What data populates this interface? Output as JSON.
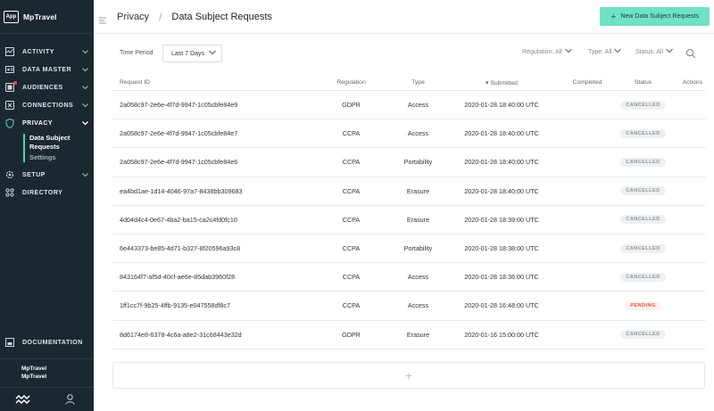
{
  "brand": {
    "logo": "App",
    "name": "MpTravel"
  },
  "nav": {
    "items": [
      {
        "label": "ACTIVITY",
        "icon": "activity-icon"
      },
      {
        "label": "DATA MASTER",
        "icon": "data-master-icon"
      },
      {
        "label": "AUDIENCES",
        "icon": "audiences-icon"
      },
      {
        "label": "CONNECTIONS",
        "icon": "connections-icon"
      },
      {
        "label": "PRIVACY",
        "icon": "shield-icon"
      },
      {
        "label": "SETUP",
        "icon": "gear-icon"
      },
      {
        "label": "DIRECTORY",
        "icon": "directory-icon"
      }
    ],
    "privacy_sub": [
      "Data Subject Requests",
      "Settings"
    ],
    "documentation": "DOCUMENTATION"
  },
  "account": {
    "line1": "MpTravel",
    "line2": "MpTravel"
  },
  "header": {
    "crumb_root": "Privacy",
    "crumb_page": "Data Subject Requests",
    "new_button": "New Data Subject Requests"
  },
  "filters": {
    "time_period_label": "Time Period",
    "time_period_value": "Last 7 Days",
    "regulation": "Regulation: All",
    "type": "Type: All",
    "status": "Status: All"
  },
  "table": {
    "headers": {
      "id": "Request ID",
      "regulation": "Regulation",
      "type": "Type",
      "submitted": "▾ Submitted",
      "completed": "Completed",
      "status": "Status",
      "actions": "Actions"
    },
    "rows": [
      {
        "id": "2a058c97-2e6e-4f7d-9947-1c05cbfe84e9",
        "regulation": "GDPR",
        "type": "Access",
        "submitted": "2020-01-28 18:40:00 UTC",
        "completed": "",
        "status": "CANCELLED"
      },
      {
        "id": "2a058c97-2e6e-4f7d-9947-1c05cbfe84e7",
        "regulation": "CCPA",
        "type": "Access",
        "submitted": "2020-01-28 18:40:00 UTC",
        "completed": "",
        "status": "CANCELLED"
      },
      {
        "id": "2a058c97-2e6e-4f7d-9947-1c05cbfe84e6",
        "regulation": "CCPA",
        "type": "Portability",
        "submitted": "2020-01-28 18:40:00 UTC",
        "completed": "",
        "status": "CANCELLED"
      },
      {
        "id": "ea4bd1ae-1d14-4046-97a7-8438bb309683",
        "regulation": "CCPA",
        "type": "Erasure",
        "submitted": "2020-01-28 18:40:00 UTC",
        "completed": "",
        "status": "CANCELLED"
      },
      {
        "id": "4d04d4c4-0e67-4ba2-ba15-ca2c4fd0fc10",
        "regulation": "CCPA",
        "type": "Erasure",
        "submitted": "2020-01-28 18:39:00 UTC",
        "completed": "",
        "status": "CANCELLED"
      },
      {
        "id": "6e443373-be85-4d71-b327-8f20596a93c8",
        "regulation": "CCPA",
        "type": "Portability",
        "submitted": "2020-01-28 18:38:00 UTC",
        "completed": "",
        "status": "CANCELLED"
      },
      {
        "id": "843164f7-af5d-40cf-ae6e-85dab3960f28",
        "regulation": "CCPA",
        "type": "Access",
        "submitted": "2020-01-28 18:36:00 UTC",
        "completed": "",
        "status": "CANCELLED"
      },
      {
        "id": "1ff1cc7f-9b25-4ffb-9135-e047558df8c7",
        "regulation": "CCPA",
        "type": "Access",
        "submitted": "2020-01-28 16:48:00 UTC",
        "completed": "",
        "status": "PENDING"
      },
      {
        "id": "8d6174e8-6378-4c6a-a8e2-31c68443e32d",
        "regulation": "GDPR",
        "type": "Erasure",
        "submitted": "2020-01-16 15:00:00 UTC",
        "completed": "",
        "status": "CANCELLED"
      }
    ]
  },
  "colors": {
    "sidebar": "#1c2830",
    "accent": "#6fe2c3",
    "pending": "#e2553f"
  }
}
